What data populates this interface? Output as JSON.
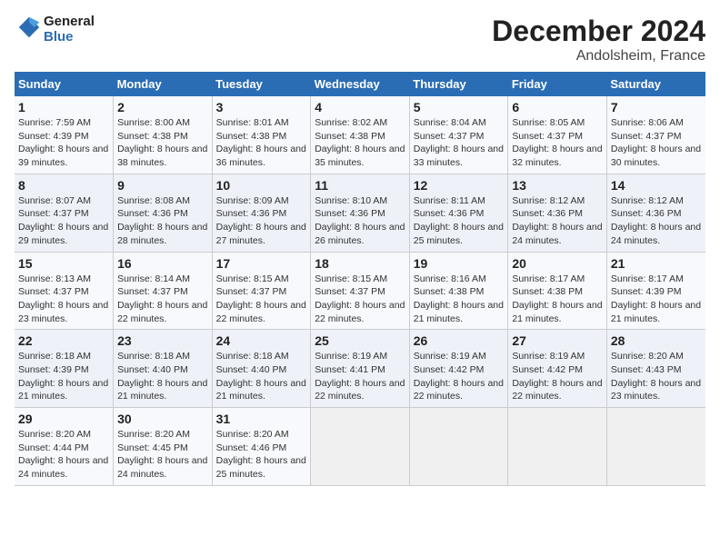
{
  "logo": {
    "text1": "General",
    "text2": "Blue"
  },
  "title": "December 2024",
  "subtitle": "Andolsheim, France",
  "headers": [
    "Sunday",
    "Monday",
    "Tuesday",
    "Wednesday",
    "Thursday",
    "Friday",
    "Saturday"
  ],
  "weeks": [
    [
      {
        "day": "1",
        "sunrise": "Sunrise: 7:59 AM",
        "sunset": "Sunset: 4:39 PM",
        "daylight": "Daylight: 8 hours and 39 minutes."
      },
      {
        "day": "2",
        "sunrise": "Sunrise: 8:00 AM",
        "sunset": "Sunset: 4:38 PM",
        "daylight": "Daylight: 8 hours and 38 minutes."
      },
      {
        "day": "3",
        "sunrise": "Sunrise: 8:01 AM",
        "sunset": "Sunset: 4:38 PM",
        "daylight": "Daylight: 8 hours and 36 minutes."
      },
      {
        "day": "4",
        "sunrise": "Sunrise: 8:02 AM",
        "sunset": "Sunset: 4:38 PM",
        "daylight": "Daylight: 8 hours and 35 minutes."
      },
      {
        "day": "5",
        "sunrise": "Sunrise: 8:04 AM",
        "sunset": "Sunset: 4:37 PM",
        "daylight": "Daylight: 8 hours and 33 minutes."
      },
      {
        "day": "6",
        "sunrise": "Sunrise: 8:05 AM",
        "sunset": "Sunset: 4:37 PM",
        "daylight": "Daylight: 8 hours and 32 minutes."
      },
      {
        "day": "7",
        "sunrise": "Sunrise: 8:06 AM",
        "sunset": "Sunset: 4:37 PM",
        "daylight": "Daylight: 8 hours and 30 minutes."
      }
    ],
    [
      {
        "day": "8",
        "sunrise": "Sunrise: 8:07 AM",
        "sunset": "Sunset: 4:37 PM",
        "daylight": "Daylight: 8 hours and 29 minutes."
      },
      {
        "day": "9",
        "sunrise": "Sunrise: 8:08 AM",
        "sunset": "Sunset: 4:36 PM",
        "daylight": "Daylight: 8 hours and 28 minutes."
      },
      {
        "day": "10",
        "sunrise": "Sunrise: 8:09 AM",
        "sunset": "Sunset: 4:36 PM",
        "daylight": "Daylight: 8 hours and 27 minutes."
      },
      {
        "day": "11",
        "sunrise": "Sunrise: 8:10 AM",
        "sunset": "Sunset: 4:36 PM",
        "daylight": "Daylight: 8 hours and 26 minutes."
      },
      {
        "day": "12",
        "sunrise": "Sunrise: 8:11 AM",
        "sunset": "Sunset: 4:36 PM",
        "daylight": "Daylight: 8 hours and 25 minutes."
      },
      {
        "day": "13",
        "sunrise": "Sunrise: 8:12 AM",
        "sunset": "Sunset: 4:36 PM",
        "daylight": "Daylight: 8 hours and 24 minutes."
      },
      {
        "day": "14",
        "sunrise": "Sunrise: 8:12 AM",
        "sunset": "Sunset: 4:36 PM",
        "daylight": "Daylight: 8 hours and 24 minutes."
      }
    ],
    [
      {
        "day": "15",
        "sunrise": "Sunrise: 8:13 AM",
        "sunset": "Sunset: 4:37 PM",
        "daylight": "Daylight: 8 hours and 23 minutes."
      },
      {
        "day": "16",
        "sunrise": "Sunrise: 8:14 AM",
        "sunset": "Sunset: 4:37 PM",
        "daylight": "Daylight: 8 hours and 22 minutes."
      },
      {
        "day": "17",
        "sunrise": "Sunrise: 8:15 AM",
        "sunset": "Sunset: 4:37 PM",
        "daylight": "Daylight: 8 hours and 22 minutes."
      },
      {
        "day": "18",
        "sunrise": "Sunrise: 8:15 AM",
        "sunset": "Sunset: 4:37 PM",
        "daylight": "Daylight: 8 hours and 22 minutes."
      },
      {
        "day": "19",
        "sunrise": "Sunrise: 8:16 AM",
        "sunset": "Sunset: 4:38 PM",
        "daylight": "Daylight: 8 hours and 21 minutes."
      },
      {
        "day": "20",
        "sunrise": "Sunrise: 8:17 AM",
        "sunset": "Sunset: 4:38 PM",
        "daylight": "Daylight: 8 hours and 21 minutes."
      },
      {
        "day": "21",
        "sunrise": "Sunrise: 8:17 AM",
        "sunset": "Sunset: 4:39 PM",
        "daylight": "Daylight: 8 hours and 21 minutes."
      }
    ],
    [
      {
        "day": "22",
        "sunrise": "Sunrise: 8:18 AM",
        "sunset": "Sunset: 4:39 PM",
        "daylight": "Daylight: 8 hours and 21 minutes."
      },
      {
        "day": "23",
        "sunrise": "Sunrise: 8:18 AM",
        "sunset": "Sunset: 4:40 PM",
        "daylight": "Daylight: 8 hours and 21 minutes."
      },
      {
        "day": "24",
        "sunrise": "Sunrise: 8:18 AM",
        "sunset": "Sunset: 4:40 PM",
        "daylight": "Daylight: 8 hours and 21 minutes."
      },
      {
        "day": "25",
        "sunrise": "Sunrise: 8:19 AM",
        "sunset": "Sunset: 4:41 PM",
        "daylight": "Daylight: 8 hours and 22 minutes."
      },
      {
        "day": "26",
        "sunrise": "Sunrise: 8:19 AM",
        "sunset": "Sunset: 4:42 PM",
        "daylight": "Daylight: 8 hours and 22 minutes."
      },
      {
        "day": "27",
        "sunrise": "Sunrise: 8:19 AM",
        "sunset": "Sunset: 4:42 PM",
        "daylight": "Daylight: 8 hours and 22 minutes."
      },
      {
        "day": "28",
        "sunrise": "Sunrise: 8:20 AM",
        "sunset": "Sunset: 4:43 PM",
        "daylight": "Daylight: 8 hours and 23 minutes."
      }
    ],
    [
      {
        "day": "29",
        "sunrise": "Sunrise: 8:20 AM",
        "sunset": "Sunset: 4:44 PM",
        "daylight": "Daylight: 8 hours and 24 minutes."
      },
      {
        "day": "30",
        "sunrise": "Sunrise: 8:20 AM",
        "sunset": "Sunset: 4:45 PM",
        "daylight": "Daylight: 8 hours and 24 minutes."
      },
      {
        "day": "31",
        "sunrise": "Sunrise: 8:20 AM",
        "sunset": "Sunset: 4:46 PM",
        "daylight": "Daylight: 8 hours and 25 minutes."
      },
      null,
      null,
      null,
      null
    ]
  ]
}
